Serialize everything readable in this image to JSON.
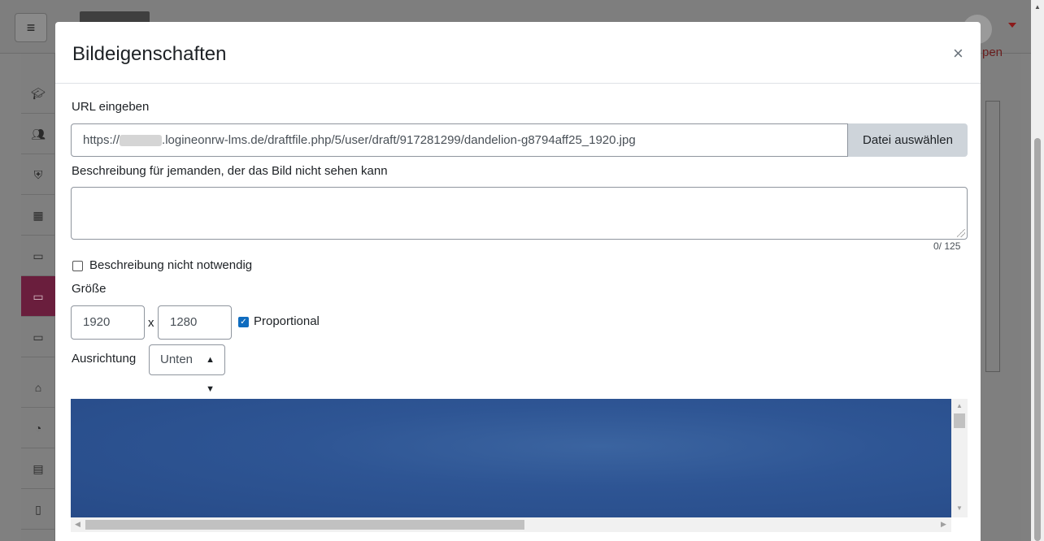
{
  "background": {
    "menu_icon": "≡",
    "right_text": "pen"
  },
  "dialog": {
    "title": "Bildeigenschaften",
    "close_icon": "×",
    "url_label": "URL eingeben",
    "url_prefix": "https://",
    "url_suffix": ".logineonrw-lms.de/draftfile.php/5/user/draft/917281299/dandelion-g8794aff25_1920.jpg",
    "file_button": "Datei auswählen",
    "description_label": "Beschreibung für jemanden, der das Bild nicht sehen kann",
    "description_value": "",
    "char_counter": "0/ 125",
    "not_necessary_label": "Beschreibung nicht notwendig",
    "size_label": "Größe",
    "width": "1920",
    "height": "1280",
    "times": "x",
    "proportional_label": "Proportional",
    "alignment_label": "Ausrichtung",
    "alignment_value": "Unten"
  }
}
